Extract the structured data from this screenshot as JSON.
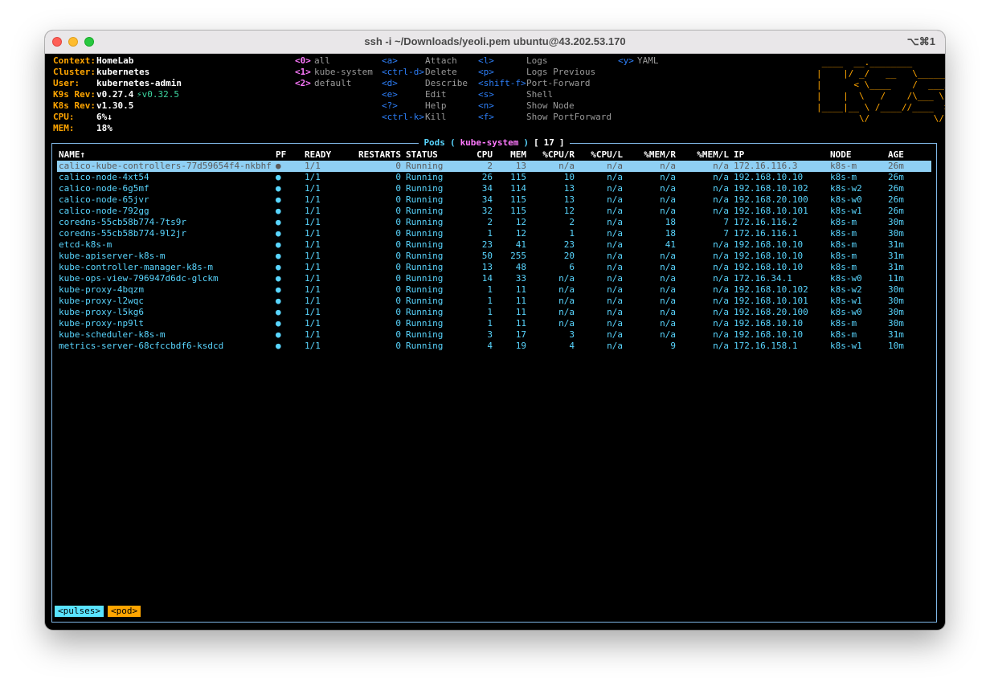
{
  "window": {
    "title": "ssh -i ~/Downloads/yeoli.pem ubuntu@43.202.53.170",
    "shortcut": "⌥⌘1"
  },
  "info": [
    {
      "label": "Context:",
      "value": "HomeLab"
    },
    {
      "label": "Cluster:",
      "value": "kubernetes"
    },
    {
      "label": "User:",
      "value": "kubernetes-admin"
    },
    {
      "label": "K9s Rev:",
      "value": "v0.27.4",
      "extra": "⚡v0.32.5"
    },
    {
      "label": "K8s Rev:",
      "value": "v1.30.5"
    },
    {
      "label": "CPU:",
      "value": "6%↓"
    },
    {
      "label": "MEM:",
      "value": "18%"
    }
  ],
  "namespaces": [
    {
      "key": "<0>",
      "label": "all"
    },
    {
      "key": "<1>",
      "label": "kube-system"
    },
    {
      "key": "<2>",
      "label": "default"
    }
  ],
  "hotkeys_col1": [
    {
      "key": "<a>",
      "label": "Attach"
    },
    {
      "key": "<ctrl-d>",
      "label": "Delete"
    },
    {
      "key": "<d>",
      "label": "Describe"
    },
    {
      "key": "<e>",
      "label": "Edit"
    },
    {
      "key": "<?>",
      "label": "Help"
    },
    {
      "key": "<ctrl-k>",
      "label": "Kill"
    }
  ],
  "hotkeys_col2": [
    {
      "key": "<l>",
      "label": "Logs"
    },
    {
      "key": "<p>",
      "label": "Logs Previous"
    },
    {
      "key": "<shift-f>",
      "label": "Port-Forward"
    },
    {
      "key": "<s>",
      "label": "Shell"
    },
    {
      "key": "<n>",
      "label": "Show Node"
    },
    {
      "key": "<f>",
      "label": "Show PortForward"
    }
  ],
  "hotkeys_col3": [
    {
      "key": "<y>",
      "label": "YAML"
    }
  ],
  "logo": " ____  __.________       \n|    |/ _/   __   \\______\n|      < \\____    /  ___/\n|    |  \\   /    /\\___ \\ \n|____|__ \\ /____//____  >\n        \\/            \\/ ",
  "panel": {
    "resource": "Pods",
    "namespace": "kube-system",
    "count": "17"
  },
  "table": {
    "columns": [
      "NAME↑",
      "PF",
      "READY",
      "RESTARTS",
      "STATUS",
      "CPU",
      "MEM",
      "%CPU/R",
      "%CPU/L",
      "%MEM/R",
      "%MEM/L",
      "IP",
      "NODE",
      "AGE"
    ],
    "rows": [
      [
        "calico-kube-controllers-77d59654f4-nkbhf",
        "●",
        "1/1",
        "0",
        "Running",
        "2",
        "13",
        "n/a",
        "n/a",
        "n/a",
        "n/a",
        "172.16.116.3",
        "k8s-m",
        "26m"
      ],
      [
        "calico-node-4xt54",
        "●",
        "1/1",
        "0",
        "Running",
        "26",
        "115",
        "10",
        "n/a",
        "n/a",
        "n/a",
        "192.168.10.10",
        "k8s-m",
        "26m"
      ],
      [
        "calico-node-6g5mf",
        "●",
        "1/1",
        "0",
        "Running",
        "34",
        "114",
        "13",
        "n/a",
        "n/a",
        "n/a",
        "192.168.10.102",
        "k8s-w2",
        "26m"
      ],
      [
        "calico-node-65jvr",
        "●",
        "1/1",
        "0",
        "Running",
        "34",
        "115",
        "13",
        "n/a",
        "n/a",
        "n/a",
        "192.168.20.100",
        "k8s-w0",
        "26m"
      ],
      [
        "calico-node-792gg",
        "●",
        "1/1",
        "0",
        "Running",
        "32",
        "115",
        "12",
        "n/a",
        "n/a",
        "n/a",
        "192.168.10.101",
        "k8s-w1",
        "26m"
      ],
      [
        "coredns-55cb58b774-7ts9r",
        "●",
        "1/1",
        "0",
        "Running",
        "2",
        "12",
        "2",
        "n/a",
        "18",
        "7",
        "172.16.116.2",
        "k8s-m",
        "30m"
      ],
      [
        "coredns-55cb58b774-9l2jr",
        "●",
        "1/1",
        "0",
        "Running",
        "1",
        "12",
        "1",
        "n/a",
        "18",
        "7",
        "172.16.116.1",
        "k8s-m",
        "30m"
      ],
      [
        "etcd-k8s-m",
        "●",
        "1/1",
        "0",
        "Running",
        "23",
        "41",
        "23",
        "n/a",
        "41",
        "n/a",
        "192.168.10.10",
        "k8s-m",
        "31m"
      ],
      [
        "kube-apiserver-k8s-m",
        "●",
        "1/1",
        "0",
        "Running",
        "50",
        "255",
        "20",
        "n/a",
        "n/a",
        "n/a",
        "192.168.10.10",
        "k8s-m",
        "31m"
      ],
      [
        "kube-controller-manager-k8s-m",
        "●",
        "1/1",
        "0",
        "Running",
        "13",
        "48",
        "6",
        "n/a",
        "n/a",
        "n/a",
        "192.168.10.10",
        "k8s-m",
        "31m"
      ],
      [
        "kube-ops-view-796947d6dc-glckm",
        "●",
        "1/1",
        "0",
        "Running",
        "14",
        "33",
        "n/a",
        "n/a",
        "n/a",
        "n/a",
        "172.16.34.1",
        "k8s-w0",
        "11m"
      ],
      [
        "kube-proxy-4bqzm",
        "●",
        "1/1",
        "0",
        "Running",
        "1",
        "11",
        "n/a",
        "n/a",
        "n/a",
        "n/a",
        "192.168.10.102",
        "k8s-w2",
        "30m"
      ],
      [
        "kube-proxy-l2wqc",
        "●",
        "1/1",
        "0",
        "Running",
        "1",
        "11",
        "n/a",
        "n/a",
        "n/a",
        "n/a",
        "192.168.10.101",
        "k8s-w1",
        "30m"
      ],
      [
        "kube-proxy-l5kg6",
        "●",
        "1/1",
        "0",
        "Running",
        "1",
        "11",
        "n/a",
        "n/a",
        "n/a",
        "n/a",
        "192.168.20.100",
        "k8s-w0",
        "30m"
      ],
      [
        "kube-proxy-np9lt",
        "●",
        "1/1",
        "0",
        "Running",
        "1",
        "11",
        "n/a",
        "n/a",
        "n/a",
        "n/a",
        "192.168.10.10",
        "k8s-m",
        "30m"
      ],
      [
        "kube-scheduler-k8s-m",
        "●",
        "1/1",
        "0",
        "Running",
        "3",
        "17",
        "3",
        "n/a",
        "n/a",
        "n/a",
        "192.168.10.10",
        "k8s-m",
        "31m"
      ],
      [
        "metrics-server-68cfccbdf6-ksdcd",
        "●",
        "1/1",
        "0",
        "Running",
        "4",
        "19",
        "4",
        "n/a",
        "9",
        "n/a",
        "172.16.158.1",
        "k8s-w1",
        "10m"
      ]
    ]
  },
  "breadcrumbs": [
    "<pulses>",
    "<pod>"
  ]
}
